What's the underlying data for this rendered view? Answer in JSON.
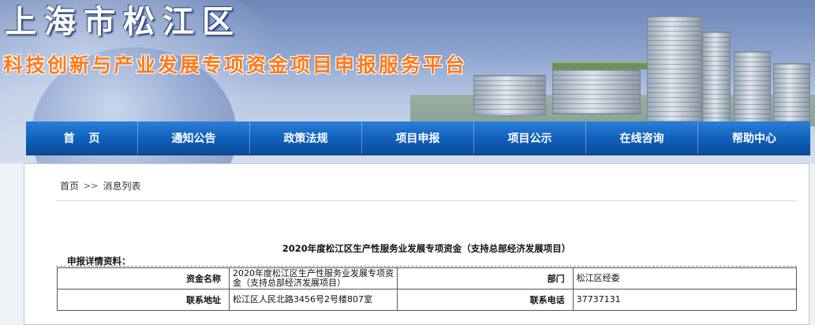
{
  "header": {
    "district": "上海市松江区",
    "platform": "科技创新与产业发展专项资金项目申报服务平台"
  },
  "nav": {
    "items": [
      {
        "label": "首页"
      },
      {
        "label": "通知公告"
      },
      {
        "label": "政策法规"
      },
      {
        "label": "项目申报"
      },
      {
        "label": "项目公示"
      },
      {
        "label": "在线咨询"
      },
      {
        "label": "帮助中心"
      }
    ]
  },
  "breadcrumb": {
    "home": "首页",
    "separator": ">>",
    "current": "消息列表"
  },
  "detail": {
    "title": "2020年度松江区生产性服务业发展专项资金（支持总部经济发展项目）",
    "section_label": "申报详情资料：",
    "rows": [
      {
        "label1": "资金名称",
        "value1": "2020年度松江区生产性服务业发展专项资金（支持总部经济发展项目）",
        "label2": "部门",
        "value2": "松江区经委"
      },
      {
        "label1": "联系地址",
        "value1": "松江区人民北路3456号2号楼807室",
        "label2": "联系电话",
        "value2": "37737131"
      }
    ]
  },
  "colors": {
    "nav_top": "#2a7fd8",
    "nav_bottom": "#0a4c99",
    "platform_title": "#ff7a1a",
    "district_title": "#ffffff"
  }
}
